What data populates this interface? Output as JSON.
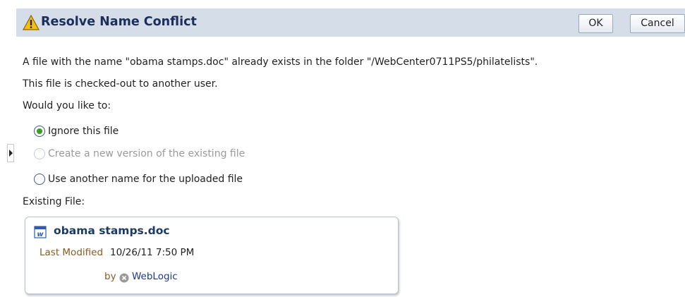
{
  "dialog": {
    "title": "Resolve Name Conflict",
    "ok_label": "OK",
    "cancel_label": "Cancel"
  },
  "message": {
    "line1": "A file with the name \"obama stamps.doc\" already exists in the folder \"/WebCenter0711PS5/philatelists\".",
    "line2": "This file is checked-out to another user.",
    "question": "Would you like to:"
  },
  "options": [
    {
      "label": "Ignore this file",
      "checked": true,
      "disabled": false
    },
    {
      "label": "Create a new version of the existing file",
      "checked": false,
      "disabled": true
    },
    {
      "label": "Use another name for the uploaded file",
      "checked": false,
      "disabled": false
    }
  ],
  "existing_file": {
    "section_label": "Existing File:",
    "name": "obama stamps.doc",
    "last_modified_label": "Last Modified",
    "last_modified_value": "10/26/11 7:50 PM",
    "by_label": "by",
    "user": "WebLogic"
  },
  "icons": {
    "warning": "warning-icon",
    "document": "word-document-icon",
    "user": "user-status-icon",
    "collapse": "expand-arrow-icon"
  },
  "colors": {
    "header_bg": "#d5dde9",
    "title": "#1b2f5a",
    "radio_selected": "#3a9e28",
    "label_brown": "#8a5a23",
    "link": "#1b3a8c"
  }
}
